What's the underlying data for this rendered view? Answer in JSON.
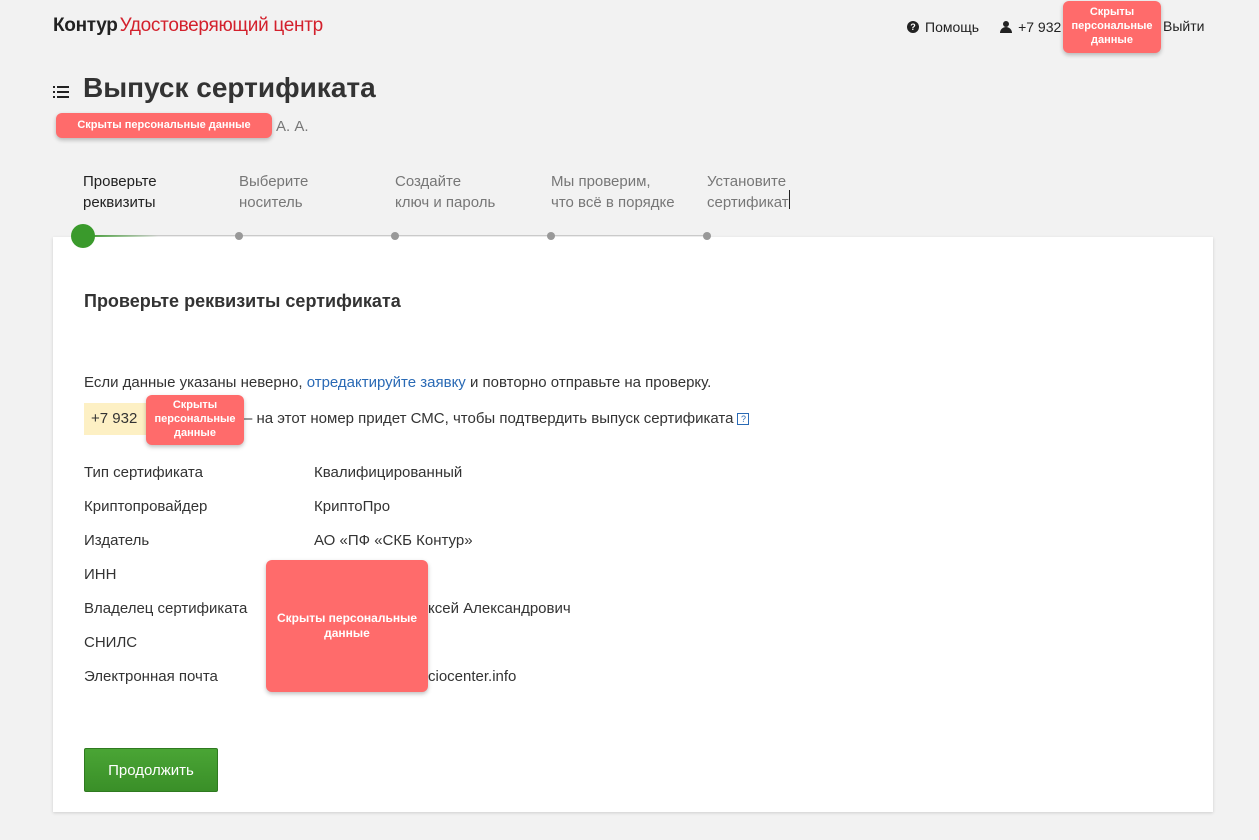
{
  "header": {
    "brand": "Контур",
    "product": "Удостоверяющий центр",
    "help_label": "Помощь",
    "phone_prefix": "+7 932",
    "logout_label": "Выйти"
  },
  "redaction_label": "Скрыты персональные данные",
  "page": {
    "title": "Выпуск сертификата",
    "subtitle_suffix": "А. А."
  },
  "steps": [
    {
      "line1": "Проверьте",
      "line2": "реквизиты",
      "active": true
    },
    {
      "line1": "Выберите",
      "line2": "носитель",
      "active": false
    },
    {
      "line1": "Создайте",
      "line2": "ключ и пароль",
      "active": false
    },
    {
      "line1": "Мы проверим,",
      "line2": "что всё в порядке",
      "active": false
    },
    {
      "line1": "Установите",
      "line2": "сертификат",
      "active": false
    }
  ],
  "card": {
    "title": "Проверьте реквизиты сертификата",
    "info_before": "Если данные указаны неверно, ",
    "info_link": "отредактируйте заявку",
    "info_after": " и повторно отправьте на проверку.",
    "phone_prefix": "+7 932",
    "sms_text": "– на этот номер придет СМС, чтобы подтвердить выпуск сертификата",
    "hint_glyph": "?",
    "rows": [
      {
        "label": "Тип сертификата",
        "value": "Квалифицированный"
      },
      {
        "label": "Криптопровайдер",
        "value": "КриптоПро"
      },
      {
        "label": "Издатель",
        "value": "АО «ПФ «СКБ Контур»"
      },
      {
        "label": "ИНН",
        "value": ""
      },
      {
        "label": "Владелец сертификата",
        "value": "ксей Александрович"
      },
      {
        "label": "СНИЛС",
        "value": ""
      },
      {
        "label": "Электронная почта",
        "value": "ciocenter.info"
      }
    ],
    "continue_label": "Продолжить"
  },
  "colors": {
    "brand_red": "#d3202c",
    "accent_green": "#3a9a2c",
    "link_blue": "#2a6ab5",
    "redaction": "#ff6b6b",
    "phone_highlight": "#fdf0c4"
  }
}
